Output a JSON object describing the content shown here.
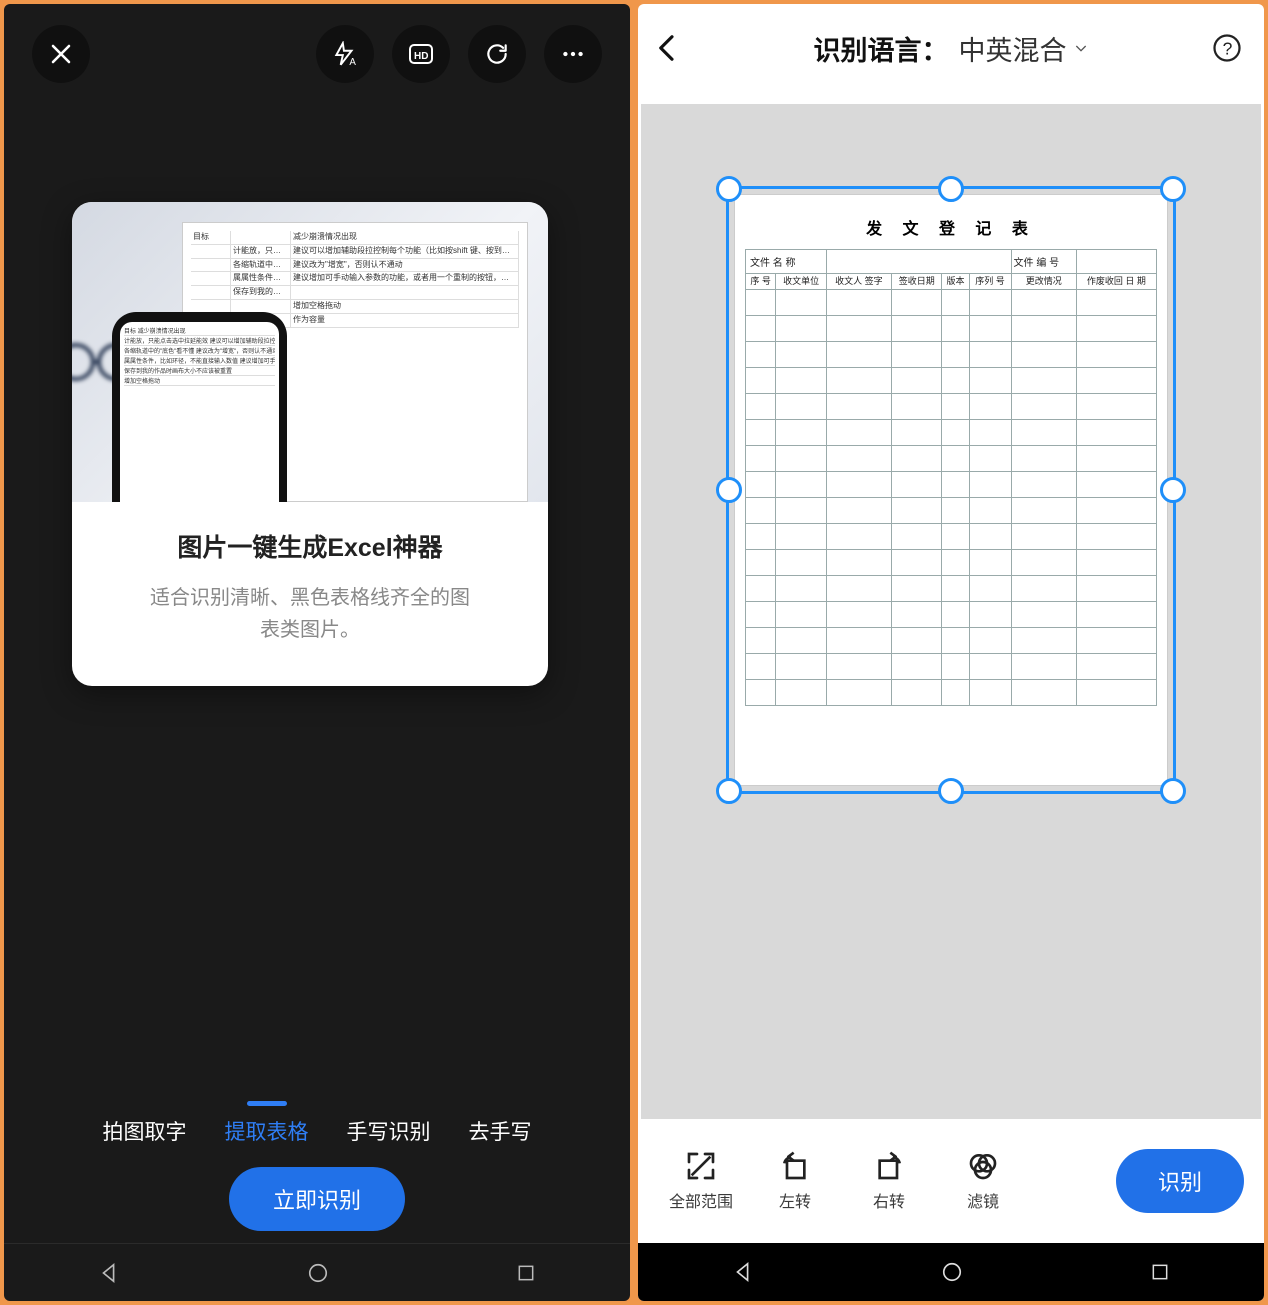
{
  "left": {
    "card": {
      "title": "图片一键生成Excel神器",
      "desc_l1": "适合识别清晰、黑色表格线齐全的图",
      "desc_l2": "表类图片。"
    },
    "sample_doc": {
      "cells": [
        [
          "目标",
          "",
          "减少崩溃情况出现"
        ],
        [
          "",
          "计能放，只能点击选中拉延能效",
          "建议可以增加辅助段拉控制每个功能（比如按shift 键、按到控制、只可崩放）"
        ],
        [
          "",
          "各缩轨道中的\"底色\"看不懂",
          "建议改为\"增宽\"，否则认不通动"
        ],
        [
          "",
          "属属性条件，比如环径，不能直接输入数值",
          "建议增加可手动输入参数的功能，或者用一个重制的按钮，一并传动了，别再不回来（拖动不到回头点查）"
        ],
        [
          "",
          "保存到我的作品时画布大小不应该被重置",
          ""
        ],
        [
          "",
          "",
          "增加空格拖动"
        ],
        [
          "",
          "",
          "作为容量"
        ]
      ]
    },
    "modes": {
      "photo_text": "拍图取字",
      "extract_table": "提取表格",
      "handwriting": "手写识别",
      "remove_handwriting": "去手写"
    },
    "main_button": "立即识别"
  },
  "right": {
    "header": {
      "label": "识别语言：",
      "language": "中英混合"
    },
    "doc": {
      "title": "发 文 登 记 表",
      "head_row1": {
        "file_name": "文件 名 称",
        "file_no": "文件 编 号"
      },
      "cols": [
        "序 号",
        "收文单位",
        "收文人 签字",
        "签收日期",
        "版本",
        "序列 号",
        "更改情况",
        "作废收回 日   期"
      ]
    },
    "toolbar": {
      "full_range": "全部范围",
      "rotate_left": "左转",
      "rotate_right": "右转",
      "filter": "滤镜"
    },
    "recognize_button": "识别"
  }
}
